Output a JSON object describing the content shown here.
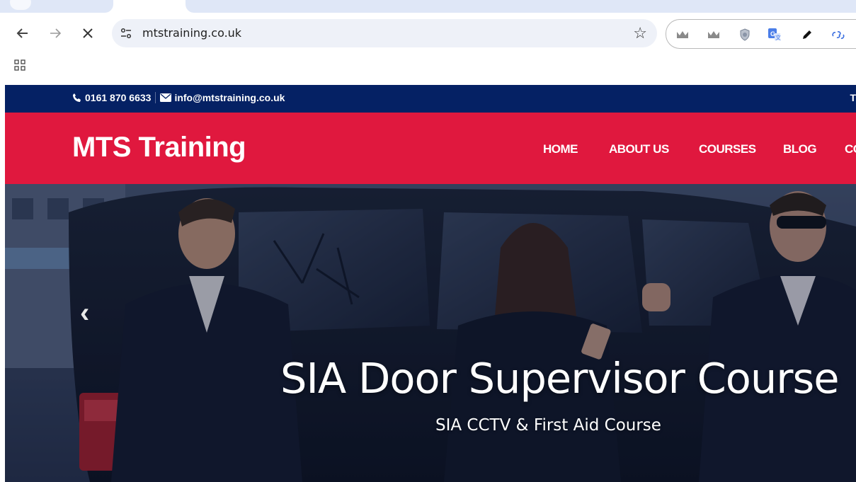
{
  "browser": {
    "url": "mtstraining.co.uk",
    "icons": {
      "back": "arrow-left-icon",
      "forward": "arrow-right-icon",
      "stop": "close-icon",
      "site_info": "tune-icon",
      "bookmark": "star-icon",
      "apps": "apps-grid-icon"
    }
  },
  "site": {
    "phone": "0161 870 6633",
    "email": "info@mtstraining.co.uk",
    "topbar_edge": "T",
    "brand": "MTS Training",
    "nav": {
      "home": "HOME",
      "about": "ABOUT US",
      "courses": "COURSES",
      "blog": "BLOG",
      "contact_partial": "CO"
    },
    "colors": {
      "topbar": "#052164",
      "header": "#e0183e"
    }
  },
  "hero": {
    "title": "SIA Door Supervisor Course",
    "subtitle": "SIA CCTV & First Aid Course",
    "prev_arrow": "‹"
  }
}
